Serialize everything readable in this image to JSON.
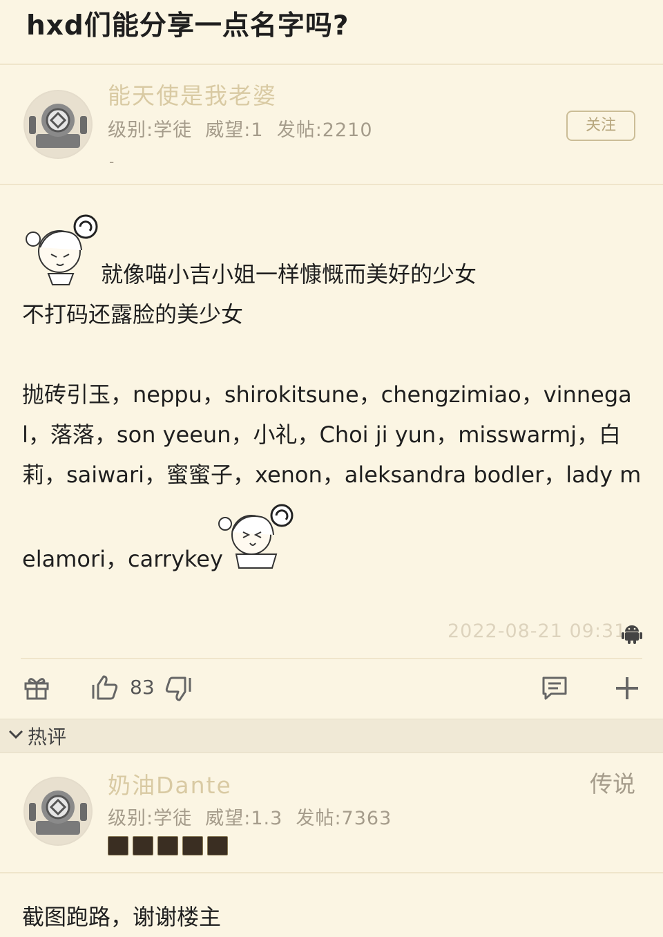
{
  "post": {
    "title": "hxd们能分享一点名字吗?",
    "author": {
      "name": "能天使是我老婆",
      "meta": "级别:学徒  威望:1  发帖:2210",
      "dot": "-"
    },
    "follow_label": "关注",
    "lines": [
      "就像喵小吉小姐一样慷慨而美好的少女",
      "不打码还露脸的美少女",
      "抛砖引玉，neppu，shirokitsune，chengzimiao，vinnega",
      "l，落落，son yeeun，小礼，Choi ji yun，misswarmj，白",
      "莉，saiwari，蜜蜜子，xenon，aleksandra bodler，lady m",
      "elamori，carrykey"
    ],
    "timestamp": "2022-08-21 09:31",
    "like_count": "83"
  },
  "hot_section": {
    "label": "热评"
  },
  "comment": {
    "author": {
      "name": "奶油Dante",
      "rank": "传说",
      "meta": "级别:学徒  威望:1.3  发帖:7363"
    },
    "text": "截图跑路，谢谢楼主"
  },
  "icons": [
    "gift-icon",
    "thumbs-up-icon",
    "thumbs-down-icon",
    "comment-icon",
    "plus-icon",
    "android-icon",
    "chevron-down-icon"
  ]
}
